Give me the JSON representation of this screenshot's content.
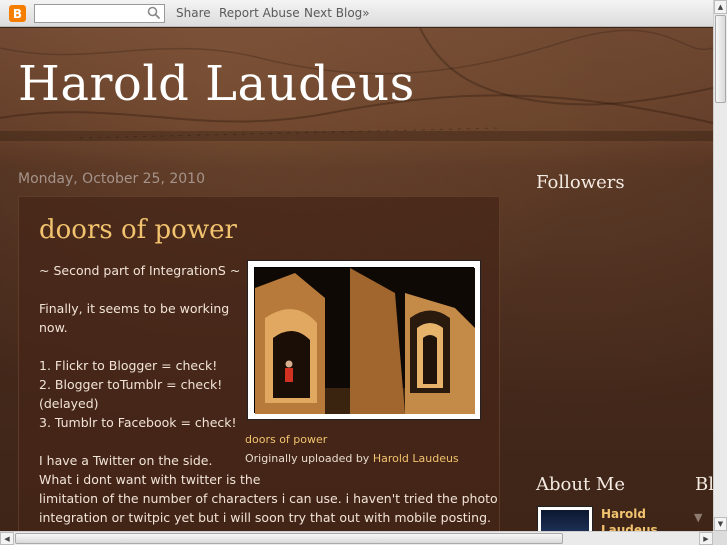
{
  "navbar": {
    "search_value": "",
    "links": [
      "Share",
      "Report Abuse",
      "Next Blog»"
    ],
    "icons": [
      "blogger-logo-icon",
      "search-icon"
    ]
  },
  "blog": {
    "title": "Harold Laudeus"
  },
  "post": {
    "date": "Monday, October 25, 2010",
    "title": "doors of power",
    "body_lines": [
      "~ Second part of IntegrationS ~",
      "",
      "Finally, it seems to be working",
      "now.",
      "",
      "1. Flickr to Blogger = check!",
      "2. Blogger toTumblr = check!",
      "(delayed)",
      "3. Tumblr to Facebook = check!",
      "",
      "I have a Twitter on the side.",
      "What i dont want with twitter is the",
      "limitation of the number of characters i can use. i haven't tried the photo",
      "integration or twitpic yet but i will soon try that out with mobile posting."
    ],
    "photo_link": "doors of power",
    "uploaded_prefix": "Originally uploaded by ",
    "uploaded_by": "Harold Laudeus"
  },
  "sidebar": {
    "followers_title": "Followers",
    "about_title": "About Me",
    "cut_title": "Bl",
    "profile_name": "Harold Laudeus",
    "collapse_icon": "triangle-down-icon"
  },
  "colors": {
    "accent": "#f2c36e",
    "background": "#3e2518",
    "text": "#f1e4d6"
  }
}
